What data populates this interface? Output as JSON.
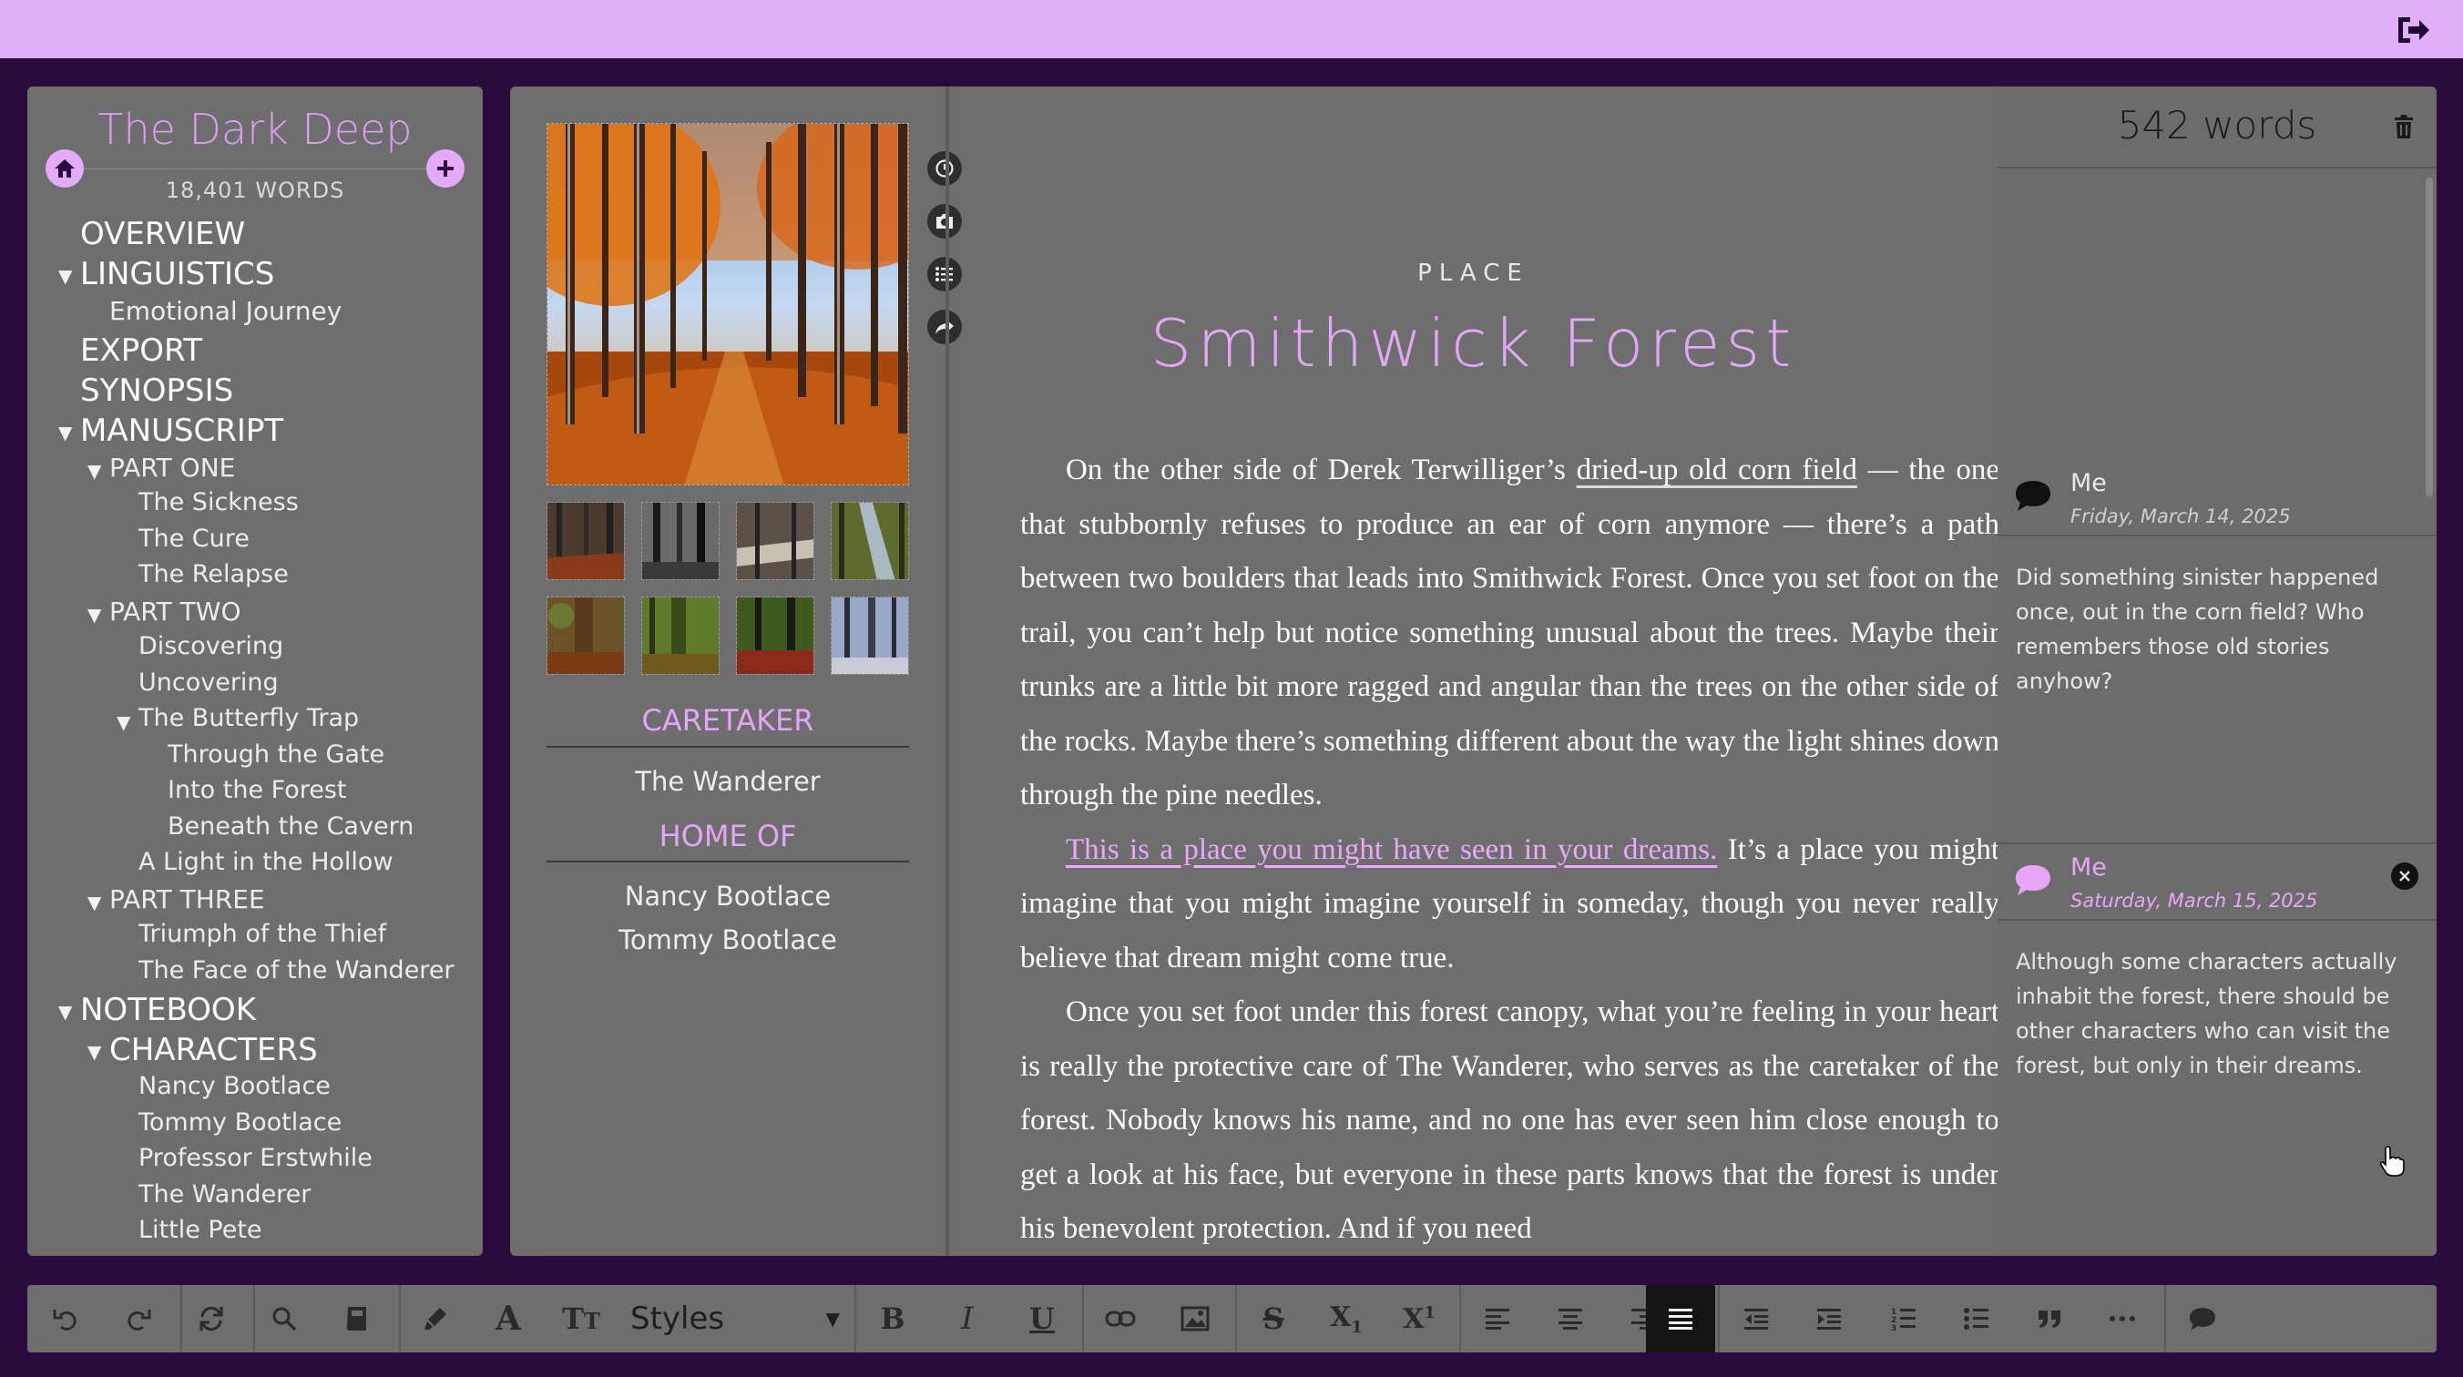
{
  "project": {
    "title": "The Dark Deep",
    "word_count": "18,401 WORDS"
  },
  "tree": [
    {
      "label": "OVERVIEW",
      "level": 0,
      "expanded": null
    },
    {
      "label": "LINGUISTICS",
      "level": 0,
      "expanded": true
    },
    {
      "label": "Emotional Journey",
      "level": 1,
      "expanded": null
    },
    {
      "label": "EXPORT",
      "level": 0,
      "expanded": null
    },
    {
      "label": "SYNOPSIS",
      "level": 0,
      "expanded": null
    },
    {
      "label": "MANUSCRIPT",
      "level": 0,
      "expanded": true
    },
    {
      "label": "PART ONE",
      "level": 1,
      "expanded": true
    },
    {
      "label": "The Sickness",
      "level": 2,
      "expanded": null
    },
    {
      "label": "The Cure",
      "level": 2,
      "expanded": null
    },
    {
      "label": "The Relapse",
      "level": 2,
      "expanded": null
    },
    {
      "label": "PART TWO",
      "level": 1,
      "expanded": true
    },
    {
      "label": "Discovering",
      "level": 2,
      "expanded": null
    },
    {
      "label": "Uncovering",
      "level": 2,
      "expanded": null
    },
    {
      "label": "The Butterfly Trap",
      "level": 2,
      "expanded": true
    },
    {
      "label": "Through the Gate",
      "level": 3,
      "expanded": null
    },
    {
      "label": "Into the Forest",
      "level": 3,
      "expanded": null
    },
    {
      "label": "Beneath the Cavern",
      "level": 3,
      "expanded": null
    },
    {
      "label": "A Light in the Hollow",
      "level": 2,
      "expanded": null
    },
    {
      "label": "PART THREE",
      "level": 1,
      "expanded": true
    },
    {
      "label": "Triumph of the Thief",
      "level": 2,
      "expanded": null
    },
    {
      "label": "The Face of the Wanderer",
      "level": 2,
      "expanded": null
    },
    {
      "label": "NOTEBOOK",
      "level": 0,
      "expanded": true
    },
    {
      "label": "CHARACTERS",
      "level": 1,
      "expanded": true,
      "big": true
    },
    {
      "label": "Nancy Bootlace",
      "level": 2,
      "expanded": null
    },
    {
      "label": "Tommy Bootlace",
      "level": 2,
      "expanded": null
    },
    {
      "label": "Professor Erstwhile",
      "level": 2,
      "expanded": null
    },
    {
      "label": "The Wanderer",
      "level": 2,
      "expanded": null
    },
    {
      "label": "Little Pete",
      "level": 2,
      "expanded": null
    }
  ],
  "info": {
    "caretaker_heading": "CARETAKER",
    "caretaker": "The Wanderer",
    "home_heading": "HOME OF",
    "residents": [
      "Nancy Bootlace",
      "Tommy Bootlace"
    ]
  },
  "document": {
    "type": "PLACE",
    "title": "Smithwick Forest",
    "p1_a": "On the other side of Derek Terwilliger’s ",
    "p1_link": "dried-up old corn field",
    "p1_b": " — the one that stubbornly refuses to produce an ear of corn anymore — there’s a path between two boulders that leads into Smithwick Forest. Once you set foot on the trail, you can’t help but notice something unusual about the trees. Maybe their trunks are a little bit more ragged and angular than the trees on the other side of the rocks. Maybe there’s something different about the way the light shines down through the pine needles.",
    "p2_link": "This is a place you might have seen in your dreams.",
    "p2_b": " It’s a place you might imagine that you might imagine yourself in someday, though you never really believe that dream might come true.",
    "p3": "Once you set foot under this forest canopy, what you’re feeling in your heart is really the protective care of The Wanderer, who serves as the caretaker of the forest. Nobody knows his name, and no one has ever seen him close enough to get a look at his face, but everyone in these parts knows that the forest is under his benevolent protection. And if you need"
  },
  "comments_panel": {
    "word_count": "542 words"
  },
  "comments": [
    {
      "author": "Me",
      "date": "Friday, March 14, 2025",
      "text": "Did something sinister happened once, out in the corn field? Who remembers those old stories anyhow?"
    },
    {
      "author": "Me",
      "date": "Saturday, March 15, 2025",
      "text": "Although some characters actually inhabit the forest, there should be other characters who can visit the forest, but only in their dreams."
    }
  ],
  "toolbar": {
    "styles_label": "Styles",
    "active_tool": "justify"
  },
  "colors": {
    "accent": "#e4a6f7",
    "topbar": "#e2aef8",
    "background": "#2a0b3e",
    "panel": "#6e6e6e"
  }
}
